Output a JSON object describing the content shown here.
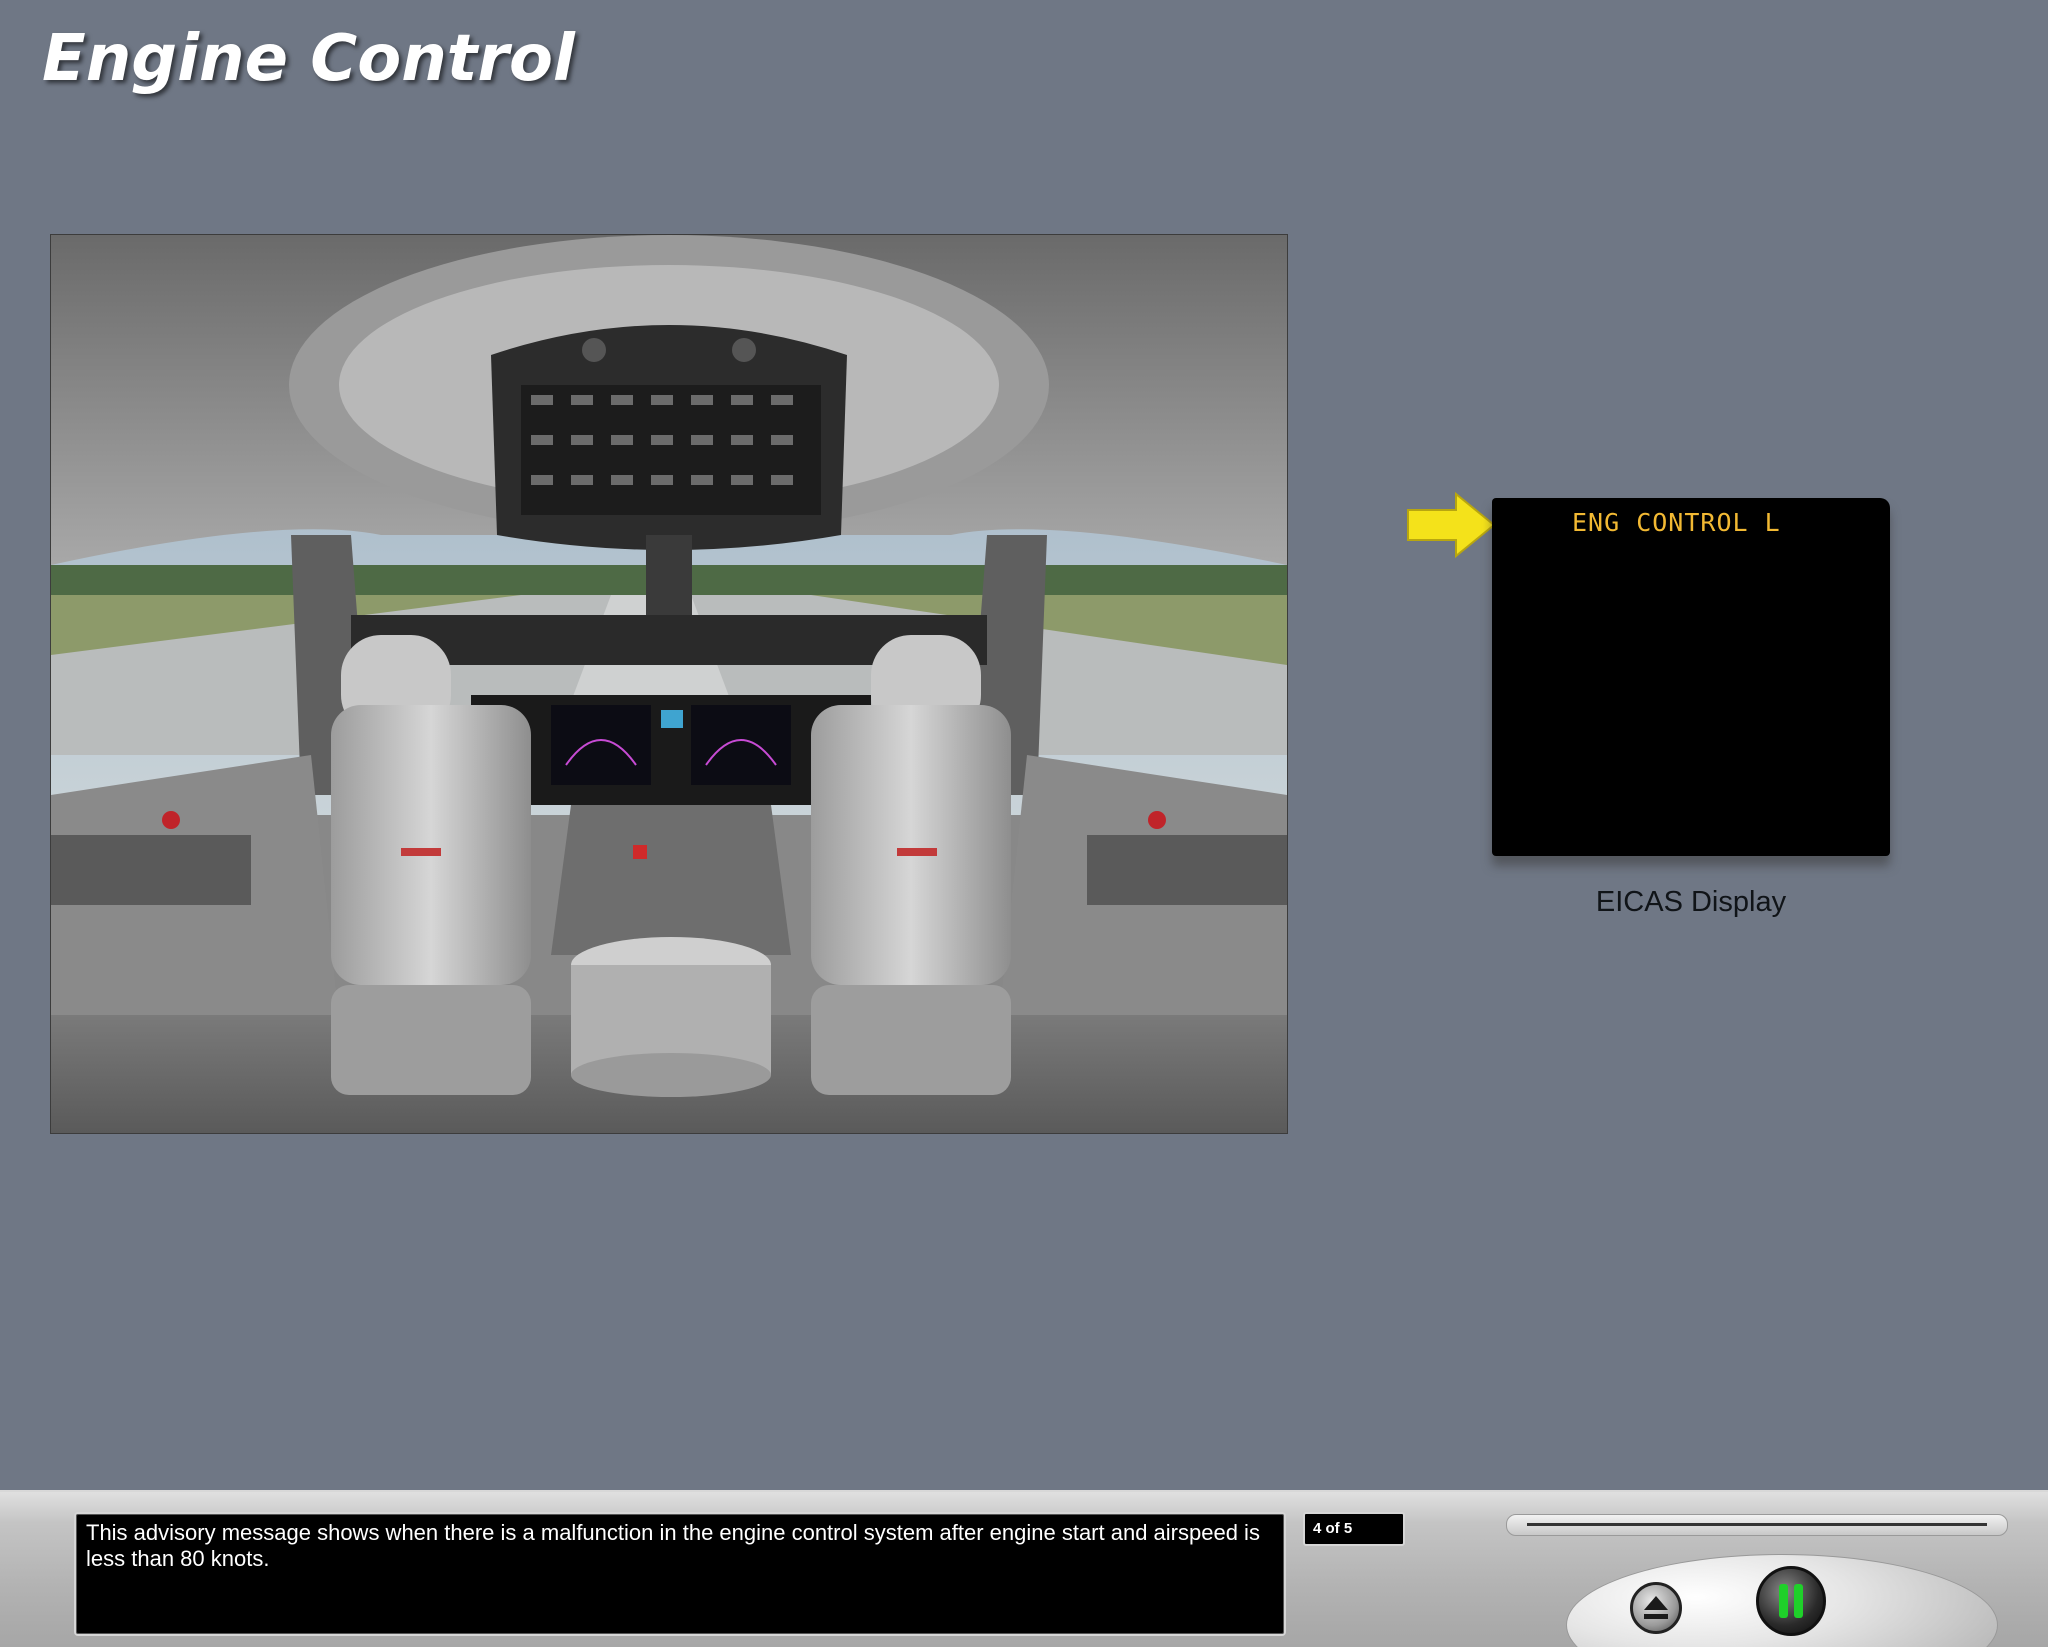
{
  "page": {
    "title": "Engine Control"
  },
  "eicas": {
    "message": "ENG CONTROL L",
    "caption": "EICAS Display",
    "message_color": "#f2b933",
    "arrow_color": "#f4e21a"
  },
  "narration": {
    "text": "This advisory message shows when there is a malfunction in the engine control system after engine start and airspeed is less than 80 knots."
  },
  "controls": {
    "page_counter": "4 of 5",
    "eject_icon": "eject-icon",
    "pause_icon": "pause-icon",
    "pause_color": "#1fd02a"
  }
}
